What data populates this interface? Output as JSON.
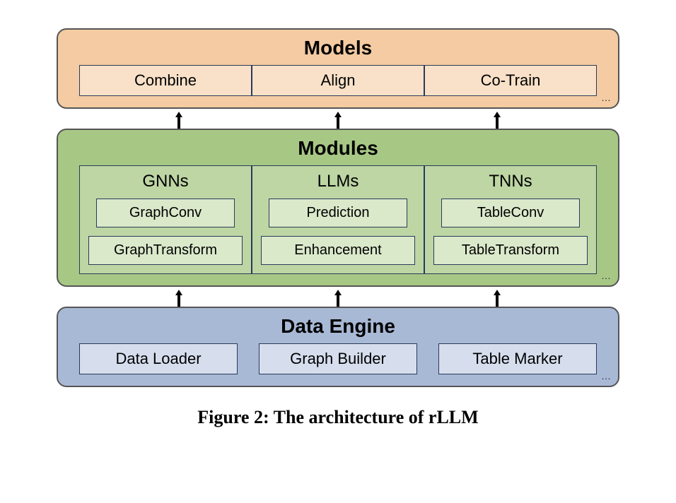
{
  "models": {
    "title": "Models",
    "items": [
      "Combine",
      "Align",
      "Co-Train"
    ],
    "ellipsis": "…"
  },
  "modules": {
    "title": "Modules",
    "groups": [
      {
        "title": "GNNs",
        "items": [
          "GraphConv",
          "GraphTransform"
        ]
      },
      {
        "title": "LLMs",
        "items": [
          "Prediction",
          "Enhancement"
        ]
      },
      {
        "title": "TNNs",
        "items": [
          "TableConv",
          "TableTransform"
        ]
      }
    ],
    "ellipsis": "…"
  },
  "dataengine": {
    "title": "Data Engine",
    "items": [
      "Data Loader",
      "Graph Builder",
      "Table Marker"
    ],
    "ellipsis": "…"
  },
  "caption": "Figure 2: The architecture of rLLM"
}
